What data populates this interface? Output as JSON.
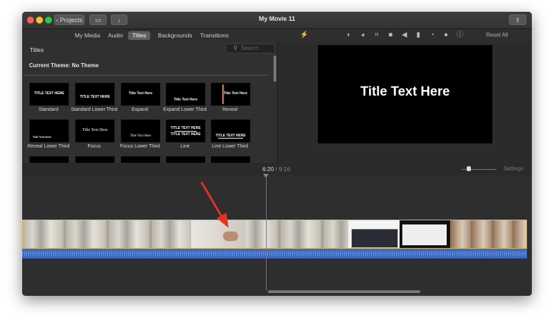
{
  "window": {
    "title": "My Movie 11",
    "projects_button": "Projects",
    "back_chevron": "‹",
    "clip_icon_glyph": "▭",
    "import_glyph": "↓",
    "share_glyph": "⇪"
  },
  "tabs": [
    {
      "label": "My Media",
      "active": false
    },
    {
      "label": "Audio",
      "active": false
    },
    {
      "label": "Titles",
      "active": true
    },
    {
      "label": "Backgrounds",
      "active": false
    },
    {
      "label": "Transitions",
      "active": false
    }
  ],
  "adjust_tools": [
    {
      "name": "magic-wand-icon",
      "glyph": "⚡"
    },
    {
      "name": "color-balance-icon",
      "glyph": "◐"
    },
    {
      "name": "color-correction-icon",
      "glyph": "◕"
    },
    {
      "name": "crop-icon",
      "glyph": "⌗"
    },
    {
      "name": "stabilization-icon",
      "glyph": "■"
    },
    {
      "name": "volume-icon",
      "glyph": "◀"
    },
    {
      "name": "noise-reduction-icon",
      "glyph": "▮"
    },
    {
      "name": "speed-icon",
      "glyph": "◔"
    },
    {
      "name": "clip-filter-icon",
      "glyph": "●"
    },
    {
      "name": "info-icon",
      "glyph": "ⓘ"
    }
  ],
  "reset_all": "Reset All",
  "browser": {
    "header": "Titles",
    "search_placeholder": "Search",
    "search_glyph": "⚲",
    "theme_label": "Current Theme: No Theme"
  },
  "titles": [
    {
      "caption": "Standard",
      "thumb_text": "TITLE TEXT HERE",
      "style": "lower"
    },
    {
      "caption": "Standard Lower Third",
      "thumb_text": "TITLE TEXT HERE",
      "style": "lower"
    },
    {
      "caption": "Expand",
      "thumb_text": "Title Text Here",
      "style": "center"
    },
    {
      "caption": "Expand Lower Third",
      "thumb_text": "Title Text Here",
      "style": "lower"
    },
    {
      "caption": "Reveal",
      "thumb_text": "Title Text Here",
      "style": "reveal"
    },
    {
      "caption": "Reveal Lower Third",
      "thumb_text": "Title Text Here",
      "style": "lowerleft"
    },
    {
      "caption": "Focus",
      "thumb_text": "Title Text Here",
      "style": "serif"
    },
    {
      "caption": "Focus Lower Third",
      "thumb_text": "Title Text Here",
      "style": "lower"
    },
    {
      "caption": "Line",
      "thumb_text": "TITLE TEXT HERE",
      "style": "line"
    },
    {
      "caption": "Line Lower Third",
      "thumb_text": "TITLE TEXT HERE",
      "style": "lower"
    }
  ],
  "viewer": {
    "title_text": "Title Text Here"
  },
  "timebar": {
    "current": "6:20",
    "separator": "/",
    "duration": "9:16",
    "settings": "Settings"
  },
  "colors": {
    "accent_selection": "#e2b84a",
    "audio_waveform": "#3b6bc4",
    "annotation_arrow": "#e8321e"
  }
}
